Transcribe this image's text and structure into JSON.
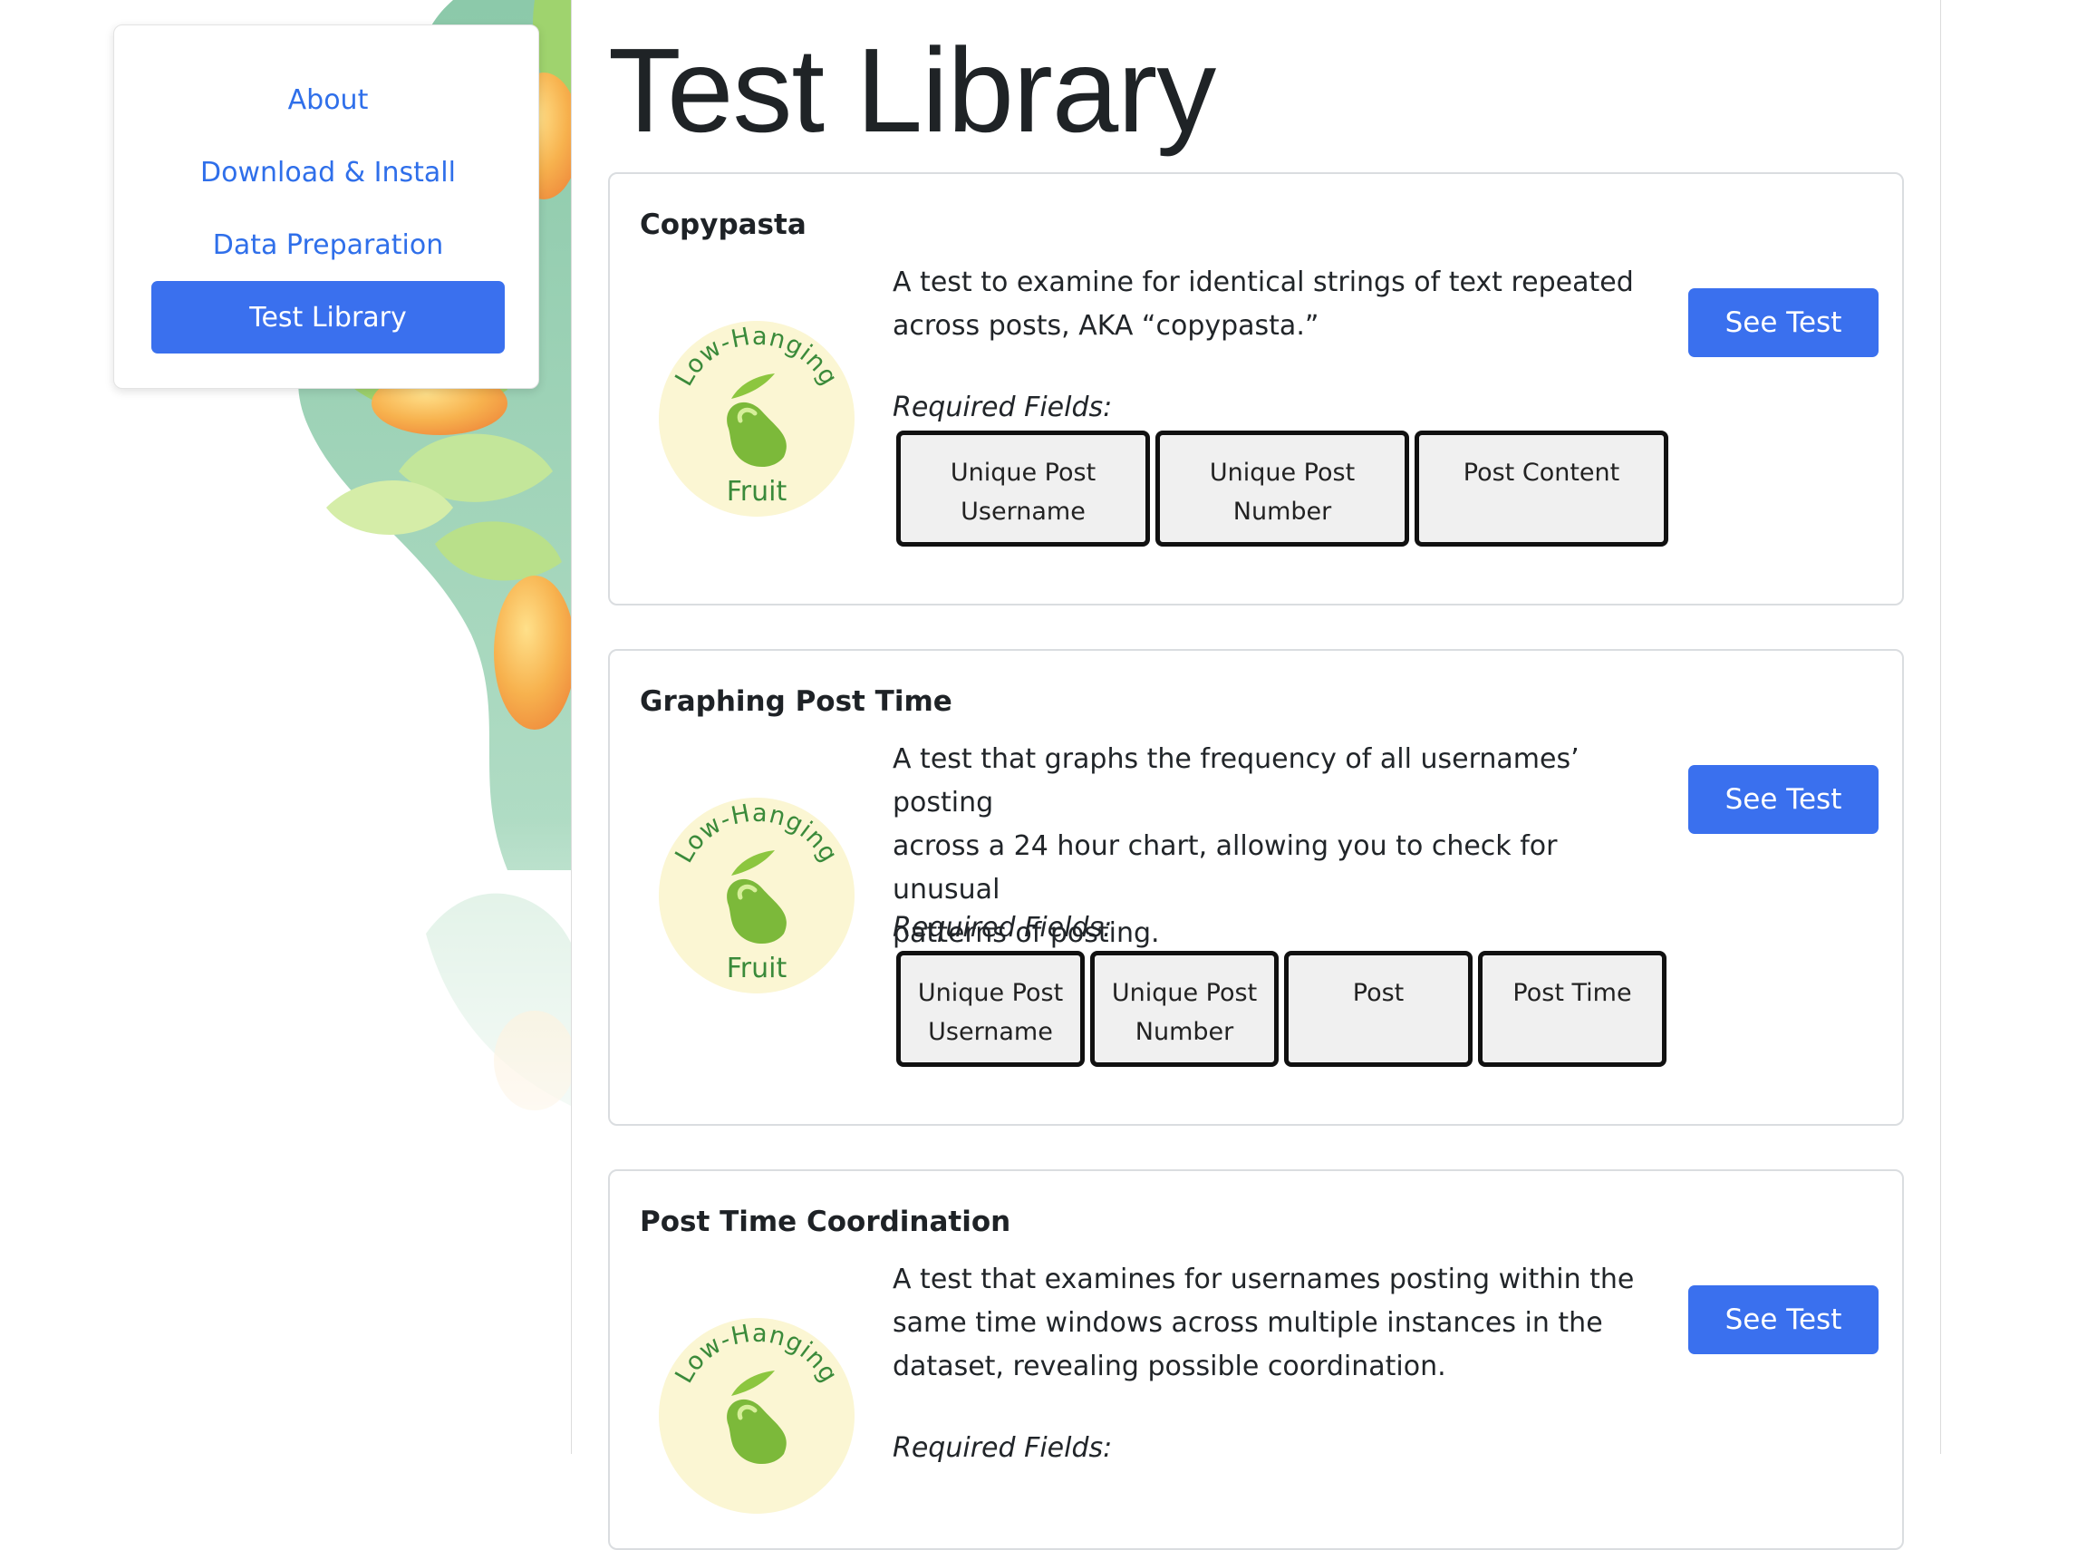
{
  "nav": {
    "items": [
      {
        "label": "About"
      },
      {
        "label": "Download & Install"
      },
      {
        "label": "Data Preparation"
      },
      {
        "label": "Test Library"
      }
    ]
  },
  "page": {
    "title": "Test Library"
  },
  "badge": {
    "top_text": "Low-Hanging",
    "bottom_text": "Fruit"
  },
  "tests": [
    {
      "title": "Copypasta",
      "description_lines": [
        "A test to examine for identical strings of text repeated",
        "across posts, AKA “copypasta.”"
      ],
      "required_label": "Required Fields:",
      "fields": [
        {
          "line1": "Unique Post",
          "line2": "Username"
        },
        {
          "line1": "Unique Post",
          "line2": "Number"
        },
        {
          "line1": "Post Content",
          "line2": ""
        }
      ],
      "button": "See Test"
    },
    {
      "title": "Graphing Post Time",
      "description_lines": [
        "A test that graphs the frequency of all usernames’ posting",
        "across a 24 hour chart, allowing you to check for unusual",
        "patterns of posting."
      ],
      "required_label": "Required Fields:",
      "fields": [
        {
          "line1": "Unique Post",
          "line2": "Username"
        },
        {
          "line1": "Unique Post",
          "line2": "Number"
        },
        {
          "line1": "Post",
          "line2": ""
        },
        {
          "line1": "Post Time",
          "line2": ""
        }
      ],
      "button": "See Test"
    },
    {
      "title": "Post Time Coordination",
      "description_lines": [
        "A test that examines for usernames posting within the",
        "same time windows across multiple instances in the",
        "dataset, revealing possible coordination."
      ],
      "required_label": "Required Fields:",
      "fields": [],
      "button": "See Test"
    }
  ]
}
